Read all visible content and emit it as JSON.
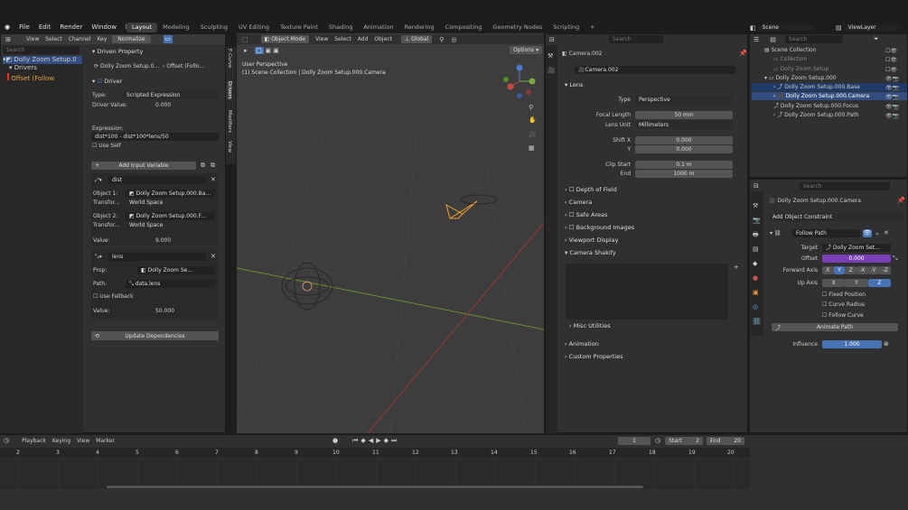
{
  "menu": [
    "File",
    "Edit",
    "Render",
    "Window",
    "Help"
  ],
  "workspaces": [
    "Layout",
    "Modeling",
    "Sculpting",
    "UV Editing",
    "Texture Paint",
    "Shading",
    "Animation",
    "Rendering",
    "Compositing",
    "Geometry Nodes",
    "Scripting"
  ],
  "scene": "Scene",
  "view_layer": "ViewLayer",
  "drivers": {
    "menu": [
      "View",
      "Select",
      "Channel",
      "Key"
    ],
    "normalize": "Normalize",
    "search_placeholder": "Search",
    "tree": [
      "Dolly Zoom Setup.0",
      "Drivers",
      "Offset (Follow"
    ],
    "driven_property": "Driven Property",
    "driven_obj": "Dolly Zoom Setup.0...",
    "driven_prop": "Offset (Follo...",
    "driver_label": "Driver",
    "type_label": "Type:",
    "type_value": "Scripted Expression",
    "driver_value_label": "Driver Value:",
    "driver_value": "0.000",
    "expression_label": "Expression:",
    "expression": "dist*100 - dist*100*lens/50",
    "use_self": "Use Self",
    "add_var": "Add Input Variable",
    "var1": {
      "name": "dist",
      "obj1_label": "Object 1:",
      "obj1": "Dolly Zoom Setup.000.Ba...",
      "transf_label": "Transfor...",
      "transf1": "World Space",
      "obj2_label": "Object 2:",
      "obj2": "Dolly Zoom Setup.000.F...",
      "transf2": "World Space",
      "value_label": "Value:",
      "value": "9.000"
    },
    "var2": {
      "name": "lens",
      "prop_label": "Prop:",
      "prop": "Dolly Zoom Se...",
      "path_label": "Path:",
      "path": "data.lens",
      "fallback": "Use Fallback",
      "value_label": "Value:",
      "value": "50.000"
    },
    "update": "Update Dependencies",
    "side_tabs": [
      "F-Curve",
      "Drivers",
      "Modifiers",
      "View"
    ]
  },
  "viewport": {
    "mode": "Object Mode",
    "menu": [
      "View",
      "Select",
      "Add",
      "Object"
    ],
    "transform": "Global",
    "options": "Options",
    "title": "User Perspective",
    "subtitle": "(1) Scene Collection | Dolly Zoom Setup.000.Camera"
  },
  "props": {
    "search_placeholder": "Search",
    "object": "Camera.002",
    "data": "Camera.002",
    "lens": "Lens",
    "type_label": "Type",
    "type": "Perspective",
    "focal_label": "Focal Length",
    "focal": "50 mm",
    "unit_label": "Lens Unit",
    "unit": "Millimeters",
    "shiftx_label": "Shift X",
    "shiftx": "0.000",
    "y_label": "Y",
    "y": "0.000",
    "clipstart_label": "Clip Start",
    "clipstart": "0.1 m",
    "end_label": "End",
    "end": "1000 m",
    "sections": [
      "Depth of Field",
      "Camera",
      "Safe Areas",
      "Background Images",
      "Viewport Display",
      "Camera Shakify"
    ],
    "misc": "Misc Utilities",
    "animation": "Animation",
    "custom": "Custom Properties"
  },
  "outliner": {
    "search_placeholder": "Search",
    "items": [
      "Scene Collection",
      "Collection",
      "Dolly Zoom Setup",
      "Dolly Zoom Setup.000",
      "Dolly Zoom Setup.000.Base",
      "Dolly Zoom Setup.000.Camera",
      "Dolly Zoom Setup.000.Focus",
      "Dolly Zoom Setup.000.Path"
    ]
  },
  "constraint": {
    "search_placeholder": "Search",
    "object": "Dolly Zoom Setup.000.Camera",
    "add": "Add Object Constraint",
    "name": "Follow Path",
    "target_label": "Target",
    "target": "Dolly Zoom Set...",
    "offset_label": "Offset",
    "offset": "0.000",
    "fwd_label": "Forward Axis",
    "fwd": [
      "X",
      "Y",
      "Z",
      "-X",
      "-Y",
      "-Z"
    ],
    "up_label": "Up Axis",
    "up": [
      "X",
      "Y",
      "Z"
    ],
    "fixed": "Fixed Position",
    "radius": "Curve Radius",
    "follow": "Follow Curve",
    "animate": "Animate Path",
    "influence_label": "Influence",
    "influence": "1.000"
  },
  "timeline": {
    "menu": [
      "Playback",
      "Keying",
      "View",
      "Marker"
    ],
    "frame": "1",
    "start_label": "Start",
    "start": "2",
    "end_label": "End",
    "end": "20",
    "ticks": [
      "2",
      "3",
      "4",
      "5",
      "6",
      "7",
      "8",
      "9",
      "10",
      "11",
      "12",
      "13",
      "14",
      "15",
      "16",
      "17",
      "18",
      "19",
      "20"
    ]
  }
}
